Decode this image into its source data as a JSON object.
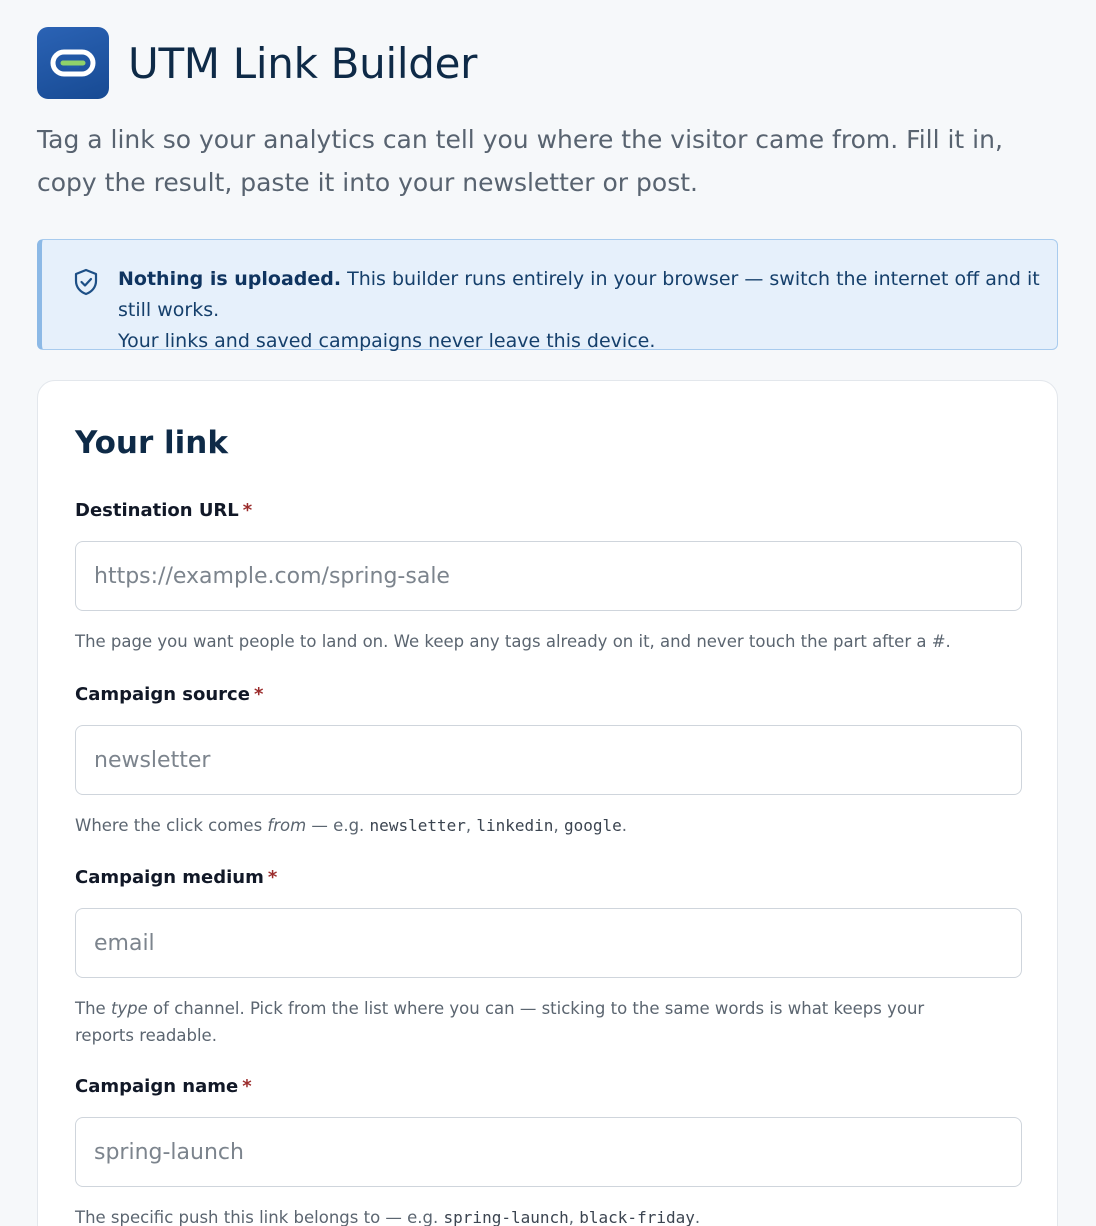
{
  "header": {
    "title": "UTM Link Builder",
    "logo_icon": "link-icon"
  },
  "intro": "Tag a link so your analytics can tell you where the visitor came from. Fill it in, copy the result, paste it into your newsletter or post.",
  "notice": {
    "icon": "shield-check-icon",
    "bold": "Nothing is uploaded.",
    "line1": " This builder runs entirely in your browser — switch the internet off and it still works.",
    "line2": "Your links and saved campaigns never leave this device."
  },
  "card": {
    "title": "Your link"
  },
  "fields": {
    "destination": {
      "label": "Destination URL",
      "required": "*",
      "value": "",
      "placeholder": "https://example.com/spring-sale",
      "help": {
        "text": "The page you want people to land on. We keep any tags already on it, and never touch the part after a #."
      }
    },
    "source": {
      "label": "Campaign source",
      "required": "*",
      "value": "",
      "placeholder": "newsletter",
      "help": {
        "before": "Where the click comes ",
        "em": "from",
        "mid": " — e.g. ",
        "code1": "newsletter",
        "sep1": ", ",
        "code2": "linkedin",
        "sep2": ", ",
        "code3": "google",
        "end": "."
      }
    },
    "medium": {
      "label": "Campaign medium",
      "required": "*",
      "value": "",
      "placeholder": "email",
      "help": {
        "before": "The ",
        "em": "type",
        "after": " of channel. Pick from the list where you can — sticking to the same words is what keeps your reports readable."
      }
    },
    "name": {
      "label": "Campaign name",
      "required": "*",
      "value": "",
      "placeholder": "spring-launch",
      "help": {
        "before": "The specific push this link belongs to — e.g. ",
        "code1": "spring-launch",
        "sep1": ", ",
        "code2": "black-friday",
        "end": "."
      }
    }
  },
  "colors": {
    "accent": "#1f5aa8",
    "heading": "#0e2a47",
    "notice_bg": "#e6f0fb",
    "required": "#9b2c2c"
  }
}
